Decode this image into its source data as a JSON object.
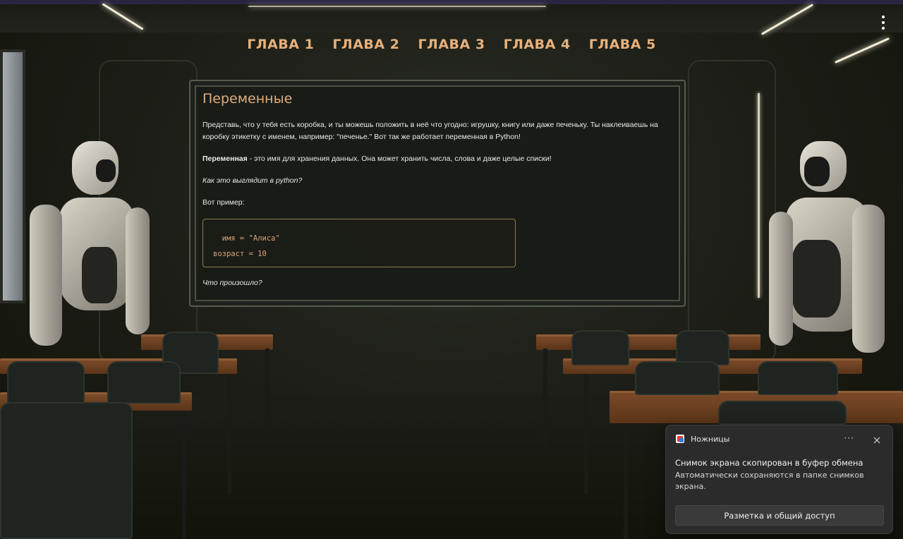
{
  "nav": {
    "chapters": [
      "ГЛАВА 1",
      "ГЛАВА 2",
      "ГЛАВА 3",
      "ГЛАВА 4",
      "ГЛАВА 5"
    ]
  },
  "lesson": {
    "title": "Переменные",
    "intro": "Представь, что у тебя есть коробка, и ты можешь положить в неё что угодно: игрушку, книгу или даже печеньку. Ты наклеиваешь на коробку этикетку с именем, например: \"печенье.\" Вот так же работает переменная в Python!",
    "definition_term": "Переменная",
    "definition_text": " - это имя для хранения данных. Она может хранить числа, слова и даже целые списки!",
    "question_how": "Как это выглядит в python?",
    "example_label": "Вот пример:",
    "code_lines": [
      "  имя = \"Алиса\"",
      "возраст = 10"
    ],
    "question_what": "Что произошло?"
  },
  "toast": {
    "app_icon": "snipping-tool-icon",
    "app_name": "Ножницы",
    "more_label": "···",
    "title": "Снимок экрана скопирован в буфер обмена",
    "body": "Автоматически сохраняются в папке снимков экрана.",
    "action_label": "Разметка и общий доступ"
  },
  "colors": {
    "accent": "#e8b07a",
    "board_bg": "#181b16",
    "code_border": "#8d7d50",
    "toast_bg": "#2b2b2b"
  }
}
